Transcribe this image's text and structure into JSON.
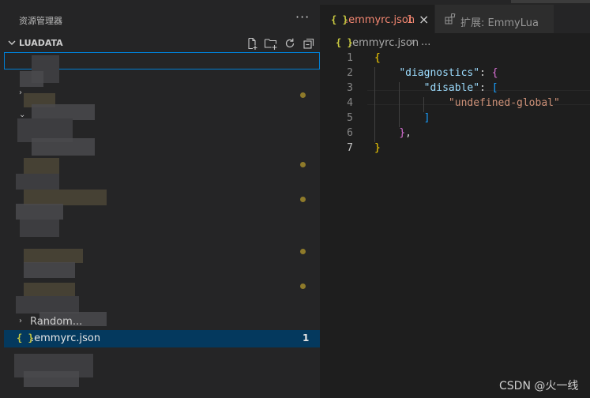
{
  "explorer": {
    "title": "资源管理器",
    "more": "···",
    "section_title": "LUADATA",
    "actions": [
      "new-file-icon",
      "new-folder-icon",
      "refresh-icon",
      "collapse-all-icon"
    ],
    "rename_value": "",
    "collapsed_folder_label": "Random...",
    "selected_file": {
      "icon": "{ }",
      "name": ".emmyrc.json",
      "problems": "1"
    }
  },
  "tabs": [
    {
      "icon": "{ }",
      "label": ".emmyrc.json",
      "problems": "1",
      "close": "×"
    },
    {
      "icon": "extensions-icon",
      "label": "扩展: EmmyLua"
    }
  ],
  "breadcrumb": {
    "icon": "{ }",
    "file": ".emmyrc.json",
    "separator": "›",
    "more": "..."
  },
  "code": {
    "line_numbers": [
      "1",
      "2",
      "3",
      "4",
      "5",
      "6",
      "7"
    ],
    "current_line": "7",
    "lines": [
      [
        {
          "t": "{",
          "c": "tok-brace"
        }
      ],
      [
        {
          "t": "    ",
          "c": ""
        },
        {
          "t": "\"diagnostics\"",
          "c": "tok-key"
        },
        {
          "t": ": ",
          "c": "tok-punc"
        },
        {
          "t": "{",
          "c": "tok-brace2"
        }
      ],
      [
        {
          "t": "        ",
          "c": ""
        },
        {
          "t": "\"disable\"",
          "c": "tok-key"
        },
        {
          "t": ": ",
          "c": "tok-punc"
        },
        {
          "t": "[",
          "c": "tok-brack"
        }
      ],
      [
        {
          "t": "            ",
          "c": ""
        },
        {
          "t": "\"undefined-global\"",
          "c": "tok-str"
        }
      ],
      [
        {
          "t": "        ",
          "c": ""
        },
        {
          "t": "]",
          "c": "tok-brack"
        }
      ],
      [
        {
          "t": "    ",
          "c": ""
        },
        {
          "t": "}",
          "c": "tok-brace2"
        },
        {
          "t": ",",
          "c": "tok-punc"
        }
      ],
      [
        {
          "t": "}",
          "c": "tok-brace"
        }
      ]
    ]
  },
  "watermark": "CSDN @火一线",
  "colors": {
    "accent": "#007fd4",
    "selection": "#04395e",
    "error_tab": "#f48771",
    "json_icon": "#cbcb41",
    "modified_dot": "#8e7a2a"
  }
}
